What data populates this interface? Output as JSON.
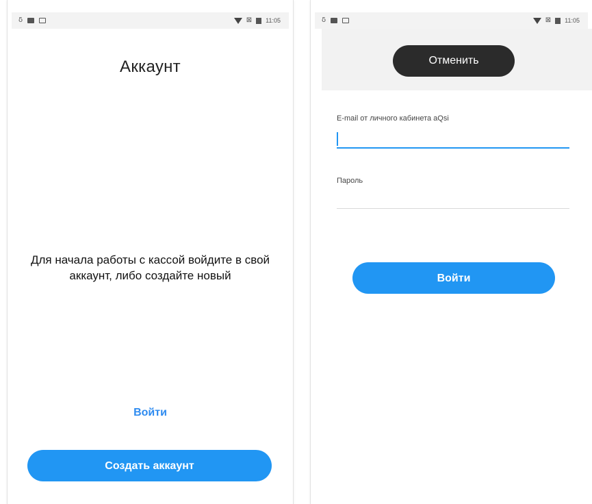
{
  "left_screen": {
    "status_bar": {
      "time": "11:05"
    },
    "title": "Аккаунт",
    "message": "Для начала работы с кассой войдите в свой аккаунт, либо создайте новый",
    "login_link": "Войти",
    "create_button": "Создать аккаунт"
  },
  "right_screen": {
    "status_bar": {
      "time": "11:05"
    },
    "cancel_button": "Отменить",
    "email_label": "E-mail от личного кабинета aQsi",
    "email_value": "",
    "password_label": "Пароль",
    "password_value": "",
    "login_button": "Войти"
  },
  "colors": {
    "accent": "#2196f3",
    "link": "#2e8bf0",
    "dark_button": "#2b2b2b"
  }
}
